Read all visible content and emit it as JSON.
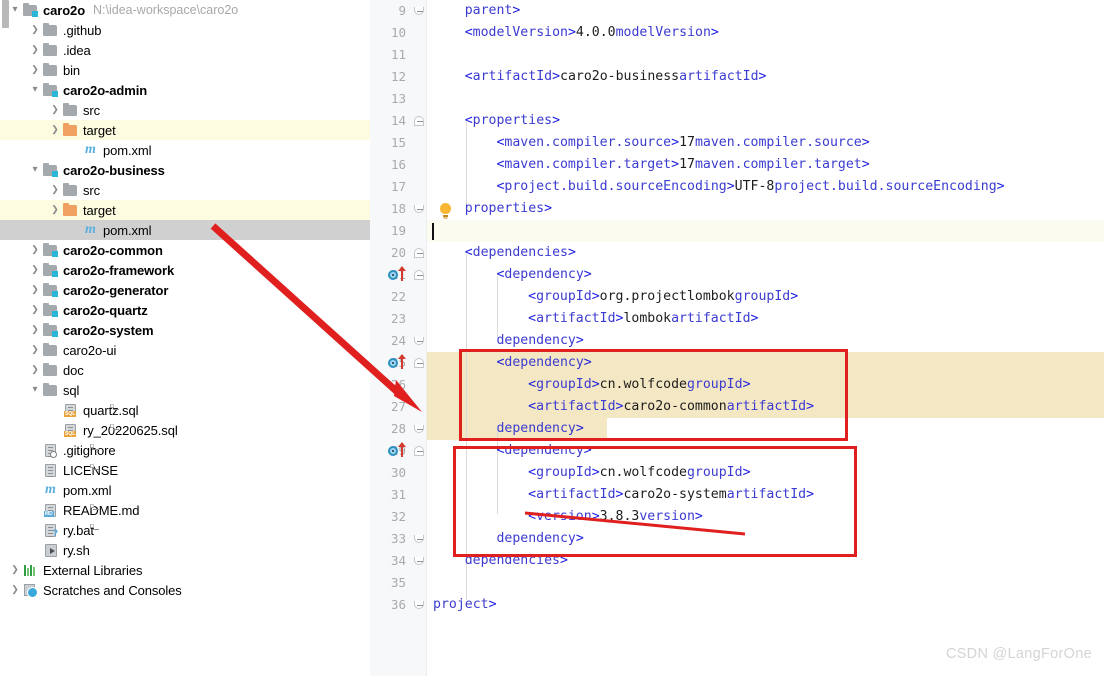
{
  "project": {
    "root_label": "caro2o",
    "root_path": "N:\\idea-workspace\\caro2o",
    "items": [
      {
        "label": ".github",
        "indent": 1,
        "arrow": "right",
        "icon": "folder-icon",
        "bold": false,
        "highlight": "none"
      },
      {
        "label": ".idea",
        "indent": 1,
        "arrow": "right",
        "icon": "folder-icon",
        "bold": false,
        "highlight": "none"
      },
      {
        "label": "bin",
        "indent": 1,
        "arrow": "right",
        "icon": "folder-icon",
        "bold": false,
        "highlight": "none"
      },
      {
        "label": "caro2o-admin",
        "indent": 1,
        "arrow": "down",
        "icon": "module-folder-icon",
        "bold": true,
        "highlight": "none"
      },
      {
        "label": "src",
        "indent": 2,
        "arrow": "right",
        "icon": "folder-icon",
        "bold": false,
        "highlight": "none"
      },
      {
        "label": "target",
        "indent": 2,
        "arrow": "right",
        "icon": "excluded-folder-icon",
        "bold": false,
        "highlight": "yellow"
      },
      {
        "label": "pom.xml",
        "indent": 3,
        "arrow": "none",
        "icon": "maven-file-icon",
        "bold": false,
        "highlight": "none"
      },
      {
        "label": "caro2o-business",
        "indent": 1,
        "arrow": "down",
        "icon": "module-folder-icon",
        "bold": true,
        "highlight": "none"
      },
      {
        "label": "src",
        "indent": 2,
        "arrow": "right",
        "icon": "folder-icon",
        "bold": false,
        "highlight": "none"
      },
      {
        "label": "target",
        "indent": 2,
        "arrow": "right",
        "icon": "excluded-folder-icon",
        "bold": false,
        "highlight": "yellow"
      },
      {
        "label": "pom.xml",
        "indent": 3,
        "arrow": "none",
        "icon": "maven-file-icon",
        "bold": false,
        "highlight": "selected"
      },
      {
        "label": "caro2o-common",
        "indent": 1,
        "arrow": "right",
        "icon": "module-folder-icon",
        "bold": true,
        "highlight": "none"
      },
      {
        "label": "caro2o-framework",
        "indent": 1,
        "arrow": "right",
        "icon": "module-folder-icon",
        "bold": true,
        "highlight": "none"
      },
      {
        "label": "caro2o-generator",
        "indent": 1,
        "arrow": "right",
        "icon": "module-folder-icon",
        "bold": true,
        "highlight": "none"
      },
      {
        "label": "caro2o-quartz",
        "indent": 1,
        "arrow": "right",
        "icon": "module-folder-icon",
        "bold": true,
        "highlight": "none"
      },
      {
        "label": "caro2o-system",
        "indent": 1,
        "arrow": "right",
        "icon": "module-folder-icon",
        "bold": true,
        "highlight": "none"
      },
      {
        "label": "caro2o-ui",
        "indent": 1,
        "arrow": "right",
        "icon": "folder-icon",
        "bold": false,
        "highlight": "none"
      },
      {
        "label": "doc",
        "indent": 1,
        "arrow": "right",
        "icon": "folder-icon",
        "bold": false,
        "highlight": "none"
      },
      {
        "label": "sql",
        "indent": 1,
        "arrow": "down",
        "icon": "folder-icon",
        "bold": false,
        "highlight": "none"
      },
      {
        "label": "quartz.sql",
        "indent": 2,
        "arrow": "none",
        "icon": "sql-file-icon",
        "bold": false,
        "highlight": "none"
      },
      {
        "label": "ry_20220625.sql",
        "indent": 2,
        "arrow": "none",
        "icon": "sql-file-icon",
        "bold": false,
        "highlight": "none"
      },
      {
        "label": ".gitignore",
        "indent": 1,
        "arrow": "none",
        "icon": "gitignore-file-icon",
        "bold": false,
        "highlight": "none"
      },
      {
        "label": "LICENSE",
        "indent": 1,
        "arrow": "none",
        "icon": "text-file-icon",
        "bold": false,
        "highlight": "none"
      },
      {
        "label": "pom.xml",
        "indent": 1,
        "arrow": "none",
        "icon": "maven-file-icon",
        "bold": false,
        "highlight": "none"
      },
      {
        "label": "README.md",
        "indent": 1,
        "arrow": "none",
        "icon": "markdown-file-icon",
        "bold": false,
        "highlight": "none"
      },
      {
        "label": "ry.bat",
        "indent": 1,
        "arrow": "none",
        "icon": "bat-file-icon",
        "bold": false,
        "highlight": "none"
      },
      {
        "label": "ry.sh",
        "indent": 1,
        "arrow": "none",
        "icon": "shell-file-icon",
        "bold": false,
        "highlight": "none"
      },
      {
        "label": "External Libraries",
        "indent": 0,
        "arrow": "right",
        "icon": "libraries-icon",
        "bold": false,
        "highlight": "none"
      },
      {
        "label": "Scratches and Consoles",
        "indent": 0,
        "arrow": "right",
        "icon": "scratches-icon",
        "bold": false,
        "highlight": "none"
      }
    ]
  },
  "editor": {
    "file": "pom.xml",
    "lines": [
      {
        "num": "9",
        "indent": 4,
        "text": "</parent>",
        "fold": "bot",
        "highlight": "none",
        "gutter": "none"
      },
      {
        "num": "10",
        "indent": 4,
        "text": "<modelVersion>4.0.0</modelVersion>",
        "fold": "none",
        "highlight": "none",
        "gutter": "none"
      },
      {
        "num": "11",
        "indent": 0,
        "text": "",
        "fold": "none",
        "highlight": "none",
        "gutter": "none"
      },
      {
        "num": "12",
        "indent": 4,
        "text": "<artifactId>caro2o-business</artifactId>",
        "fold": "none",
        "highlight": "none",
        "gutter": "none"
      },
      {
        "num": "13",
        "indent": 0,
        "text": "",
        "fold": "none",
        "highlight": "none",
        "gutter": "none"
      },
      {
        "num": "14",
        "indent": 4,
        "text": "<properties>",
        "fold": "top",
        "highlight": "none",
        "gutter": "none"
      },
      {
        "num": "15",
        "indent": 8,
        "text": "<maven.compiler.source>17</maven.compiler.source>",
        "fold": "none",
        "highlight": "none",
        "gutter": "none"
      },
      {
        "num": "16",
        "indent": 8,
        "text": "<maven.compiler.target>17</maven.compiler.target>",
        "fold": "none",
        "highlight": "none",
        "gutter": "none"
      },
      {
        "num": "17",
        "indent": 8,
        "text": "<project.build.sourceEncoding>UTF-8</project.build.sourceEncoding>",
        "fold": "none",
        "highlight": "none",
        "gutter": "none"
      },
      {
        "num": "18",
        "indent": 4,
        "text": "</properties>",
        "fold": "bot",
        "highlight": "none",
        "gutter": "bulb"
      },
      {
        "num": "19",
        "indent": 0,
        "text": "",
        "fold": "none",
        "highlight": "caret",
        "gutter": "none"
      },
      {
        "num": "20",
        "indent": 4,
        "text": "<dependencies>",
        "fold": "top",
        "highlight": "none",
        "gutter": "none"
      },
      {
        "num": "21",
        "indent": 8,
        "text": "<dependency>",
        "fold": "top",
        "highlight": "none",
        "gutter": "run"
      },
      {
        "num": "22",
        "indent": 12,
        "text": "<groupId>org.projectlombok</groupId>",
        "fold": "none",
        "highlight": "none",
        "gutter": "none"
      },
      {
        "num": "23",
        "indent": 12,
        "text": "<artifactId>lombok</artifactId>",
        "fold": "none",
        "highlight": "none",
        "gutter": "none"
      },
      {
        "num": "24",
        "indent": 8,
        "text": "</dependency>",
        "fold": "bot",
        "highlight": "none",
        "gutter": "none"
      },
      {
        "num": "25",
        "indent": 8,
        "text": "<dependency>",
        "fold": "top",
        "highlight": "sel",
        "gutter": "run"
      },
      {
        "num": "26",
        "indent": 12,
        "text": "<groupId>cn.wolfcode</groupId>",
        "fold": "none",
        "highlight": "sel",
        "gutter": "none"
      },
      {
        "num": "27",
        "indent": 12,
        "text": "<artifactId>caro2o-common</artifactId>",
        "fold": "none",
        "highlight": "sel",
        "gutter": "none"
      },
      {
        "num": "28",
        "indent": 8,
        "text": "</dependency>",
        "fold": "bot",
        "highlight": "sel-partial",
        "gutter": "none"
      },
      {
        "num": "29",
        "indent": 8,
        "text": "<dependency>",
        "fold": "top",
        "highlight": "none",
        "gutter": "run"
      },
      {
        "num": "30",
        "indent": 12,
        "text": "<groupId>cn.wolfcode</groupId>",
        "fold": "none",
        "highlight": "none",
        "gutter": "none"
      },
      {
        "num": "31",
        "indent": 12,
        "text": "<artifactId>caro2o-system</artifactId>",
        "fold": "none",
        "highlight": "none",
        "gutter": "none"
      },
      {
        "num": "32",
        "indent": 12,
        "text": "<version>3.8.3</version>",
        "fold": "none",
        "highlight": "none",
        "gutter": "none"
      },
      {
        "num": "33",
        "indent": 8,
        "text": "</dependency>",
        "fold": "bot",
        "highlight": "none",
        "gutter": "none"
      },
      {
        "num": "34",
        "indent": 4,
        "text": "</dependencies>",
        "fold": "bot",
        "highlight": "none",
        "gutter": "none"
      },
      {
        "num": "35",
        "indent": 0,
        "text": "",
        "fold": "none",
        "highlight": "none",
        "gutter": "none"
      },
      {
        "num": "36",
        "indent": 0,
        "text": "</project>",
        "fold": "bot",
        "highlight": "none",
        "gutter": "none"
      }
    ]
  },
  "annotations": {
    "accent_color": "#e01f1f",
    "arrow_label": "arrow-from-pom-to-dependency",
    "box1_label": "highlight-box-caro2o-common-dependency",
    "box2_label": "highlight-box-caro2o-system-dependency",
    "strike_label": "strikethrough-version-3.8.3"
  },
  "watermark": {
    "text": "CSDN @LangForOne"
  }
}
